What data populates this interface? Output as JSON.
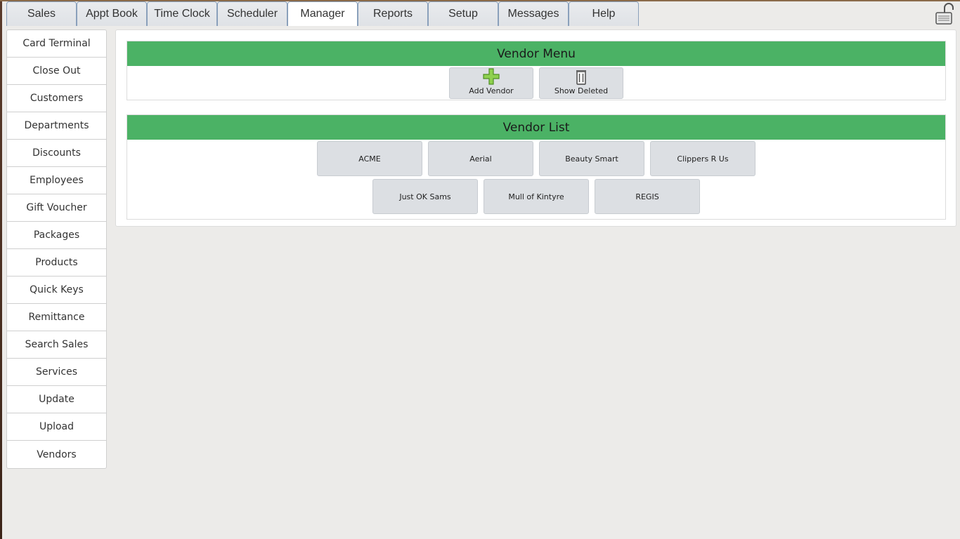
{
  "tabs": [
    {
      "label": "Sales"
    },
    {
      "label": "Appt Book"
    },
    {
      "label": "Time Clock"
    },
    {
      "label": "Scheduler"
    },
    {
      "label": "Manager",
      "active": true
    },
    {
      "label": "Reports"
    },
    {
      "label": "Setup"
    },
    {
      "label": "Messages"
    },
    {
      "label": "Help"
    }
  ],
  "lock_icon": "unlocked-padlock-icon",
  "sidebar": {
    "items": [
      {
        "label": "Card Terminal"
      },
      {
        "label": "Close Out"
      },
      {
        "label": "Customers"
      },
      {
        "label": "Departments"
      },
      {
        "label": "Discounts"
      },
      {
        "label": "Employees"
      },
      {
        "label": "Gift Voucher"
      },
      {
        "label": "Packages"
      },
      {
        "label": "Products"
      },
      {
        "label": "Quick Keys"
      },
      {
        "label": "Remittance"
      },
      {
        "label": "Search Sales"
      },
      {
        "label": "Services"
      },
      {
        "label": "Update"
      },
      {
        "label": "Upload"
      },
      {
        "label": "Vendors"
      }
    ]
  },
  "vendor_menu": {
    "title": "Vendor Menu",
    "add_label": "Add Vendor",
    "add_icon": "green-plus-icon",
    "show_deleted_label": "Show Deleted",
    "show_deleted_icon": "trash-can-icon"
  },
  "vendor_list": {
    "title": "Vendor List",
    "rows": [
      [
        "ACME",
        "Aerial",
        "Beauty Smart",
        "Clippers R Us"
      ],
      [
        "Just OK Sams",
        "Mull of Kintyre",
        "REGIS"
      ]
    ]
  },
  "colors": {
    "header_green": "#4bb265",
    "button_gray": "#dcdfe3",
    "background": "#ecebe9"
  }
}
